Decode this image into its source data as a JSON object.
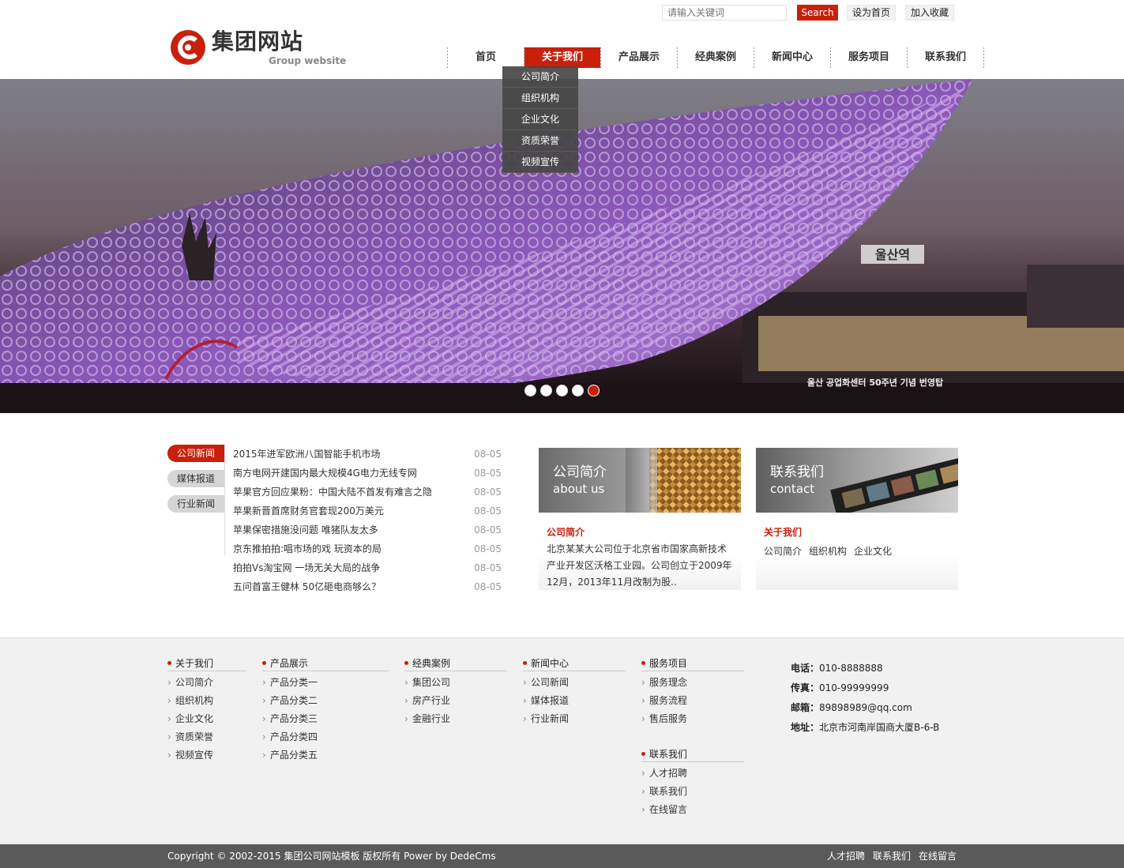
{
  "top": {
    "search_placeholder": "请输入关键词",
    "search_button": "Search",
    "set_home": "设为首页",
    "add_favorite": "加入收藏"
  },
  "logo": {
    "title": "集团网站",
    "subtitle": "Group website"
  },
  "nav": {
    "items": [
      "首页",
      "关于我们",
      "产品展示",
      "经典案例",
      "新闻中心",
      "服务项目",
      "联系我们"
    ],
    "active": "关于我们",
    "dropdown": [
      "公司简介",
      "组织机构",
      "企业文化",
      "资质荣誉",
      "视频宣传"
    ]
  },
  "banner": {
    "caption": "울산 공업화센터 50주년 기념 번영탑",
    "sign": "울산역",
    "slides": 5,
    "active_slide": 5
  },
  "news": {
    "tabs": [
      "公司新闻",
      "媒体报道",
      "行业新闻"
    ],
    "active_tab": "公司新闻",
    "items": [
      {
        "title": "2015年进军欧洲八国智能手机市场",
        "date": "08-05"
      },
      {
        "title": "南方电网开建国内最大规模4G电力无线专网",
        "date": "08-05"
      },
      {
        "title": "苹果官方回应果粉：中国大陆不首发有难言之隐",
        "date": "08-05"
      },
      {
        "title": "苹果新晋首席财务官套现200万美元",
        "date": "08-05"
      },
      {
        "title": "苹果保密措施没问题 唯猪队友太多",
        "date": "08-05"
      },
      {
        "title": "京东推拍拍:唱市场的戏 玩资本的局",
        "date": "08-05"
      },
      {
        "title": "拍拍Vs淘宝网 一场无关大局的战争",
        "date": "08-05"
      },
      {
        "title": "五问首富王健林 50亿砸电商够么？",
        "date": "08-05"
      }
    ]
  },
  "about_box": {
    "title": "公司简介",
    "subtitle": "about us",
    "heading": "公司简介",
    "text": "北京某某大公司位于北京省市国家高新技术产业开发区沃格工业园。公司创立于2009年12月，2013年11月改制为股.."
  },
  "contact_box": {
    "title": "联系我们",
    "subtitle": "contact",
    "heading": "关于我们",
    "links": [
      "公司简介",
      "组织机构",
      "企业文化"
    ]
  },
  "footer": {
    "columns": [
      {
        "title": "关于我们",
        "links": [
          "公司简介",
          "组织机构",
          "企业文化",
          "资质荣誉",
          "视频宣传"
        ]
      },
      {
        "title": "产品展示",
        "links": [
          "产品分类一",
          "产品分类二",
          "产品分类三",
          "产品分类四",
          "产品分类五"
        ]
      },
      {
        "title": "经典案例",
        "links": [
          "集团公司",
          "房产行业",
          "金融行业"
        ]
      },
      {
        "title": "新闻中心",
        "links": [
          "公司新闻",
          "媒体报道",
          "行业新闻"
        ]
      },
      {
        "title": "服务项目",
        "links": [
          "服务理念",
          "服务流程",
          "售后服务"
        ]
      },
      {
        "title": "联系我们",
        "links": [
          "人才招聘",
          "联系我们",
          "在线留言"
        ]
      }
    ],
    "contact": {
      "phone_label": "电话：",
      "phone": "010-8888888",
      "fax_label": "传真：",
      "fax": "010-99999999",
      "email_label": "邮箱：",
      "email": "89898989@qq.com",
      "address_label": "地址：",
      "address": "北京市河南岸国商大厦B-6-B"
    }
  },
  "bottom": {
    "copyright": "Copyright © 2002-2015 集团公司网站模板 版权所有 Power by DedeCms",
    "links": [
      "人才招聘",
      "联系我们",
      "在线留言"
    ]
  },
  "colors": {
    "accent": "#c8200b",
    "footer_bg": "#f1f1f1",
    "bottom_bg": "#5a5a5a"
  }
}
